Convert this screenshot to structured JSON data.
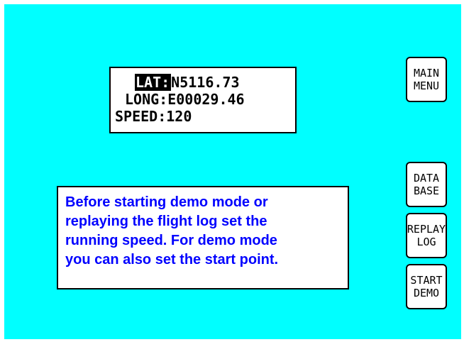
{
  "position": {
    "lat_label": "LAT:",
    "lat_value": "N5116.73",
    "long_label": "LONG:",
    "long_value": "E00029.46",
    "speed_label": "SPEED:",
    "speed_value": "120"
  },
  "info": {
    "lines": [
      "Before starting demo mode or",
      "replaying the flight log set the",
      "running speed. For demo mode",
      "you can also set the start point."
    ]
  },
  "buttons": {
    "main_menu": [
      "MAIN",
      "MENU"
    ],
    "data_base": [
      "DATA",
      "BASE"
    ],
    "replay_log": [
      "REPLAY",
      "LOG"
    ],
    "start_demo": [
      "START",
      "DEMO"
    ]
  },
  "colors": {
    "background": "#00ffff",
    "info_text": "#0000ff",
    "panel": "#ffffff",
    "border": "#000000"
  }
}
